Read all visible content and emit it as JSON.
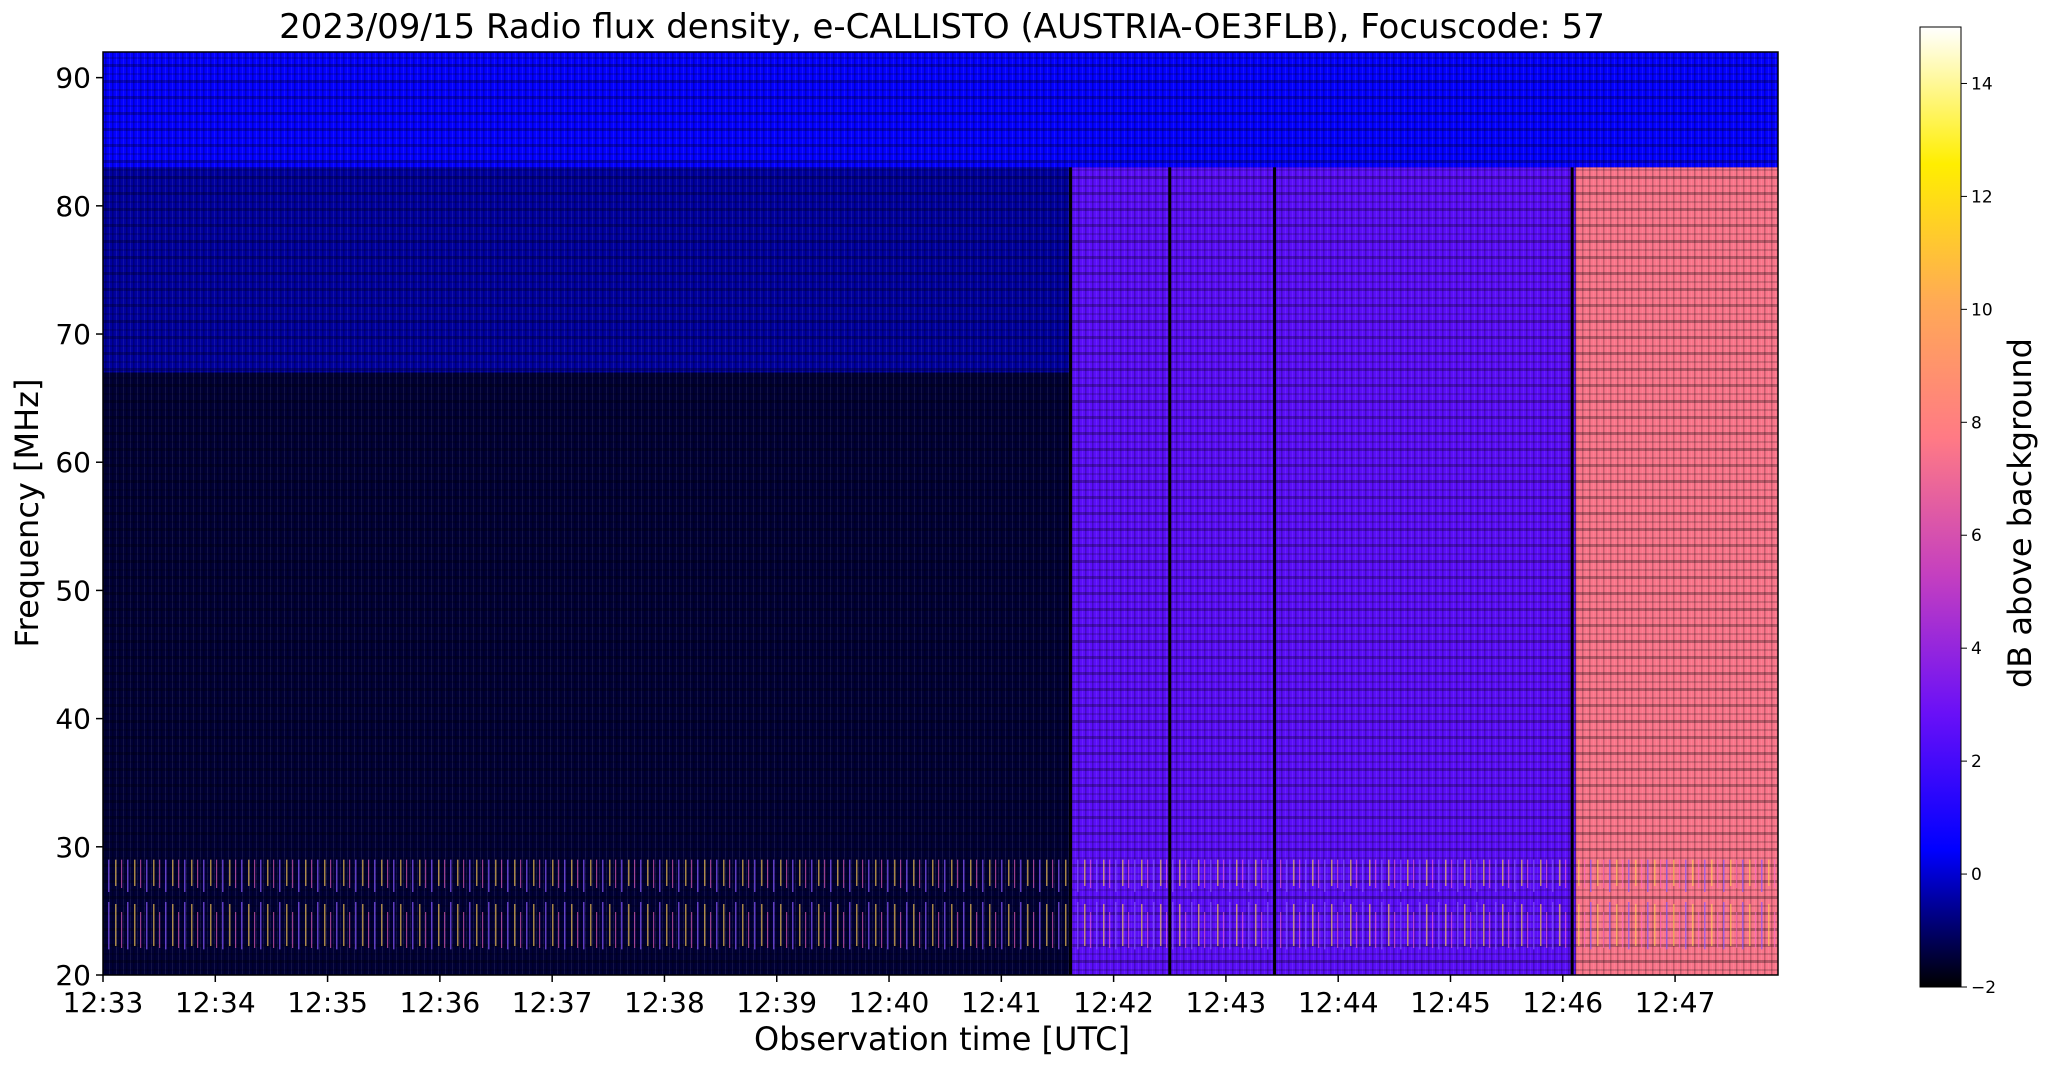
{
  "chart_data": [
    {
      "type": "heatmap",
      "title": "2023/09/15  Radio flux density, e-CALLISTO (AUSTRIA-OE3FLB), Focuscode: 57",
      "xlabel": "Observation time [UTC]",
      "ylabel": "Frequency [MHz]",
      "x_tick_labels": [
        "12:33",
        "12:34",
        "12:35",
        "12:36",
        "12:37",
        "12:38",
        "12:39",
        "12:40",
        "12:41",
        "12:42",
        "12:43",
        "12:44",
        "12:45",
        "12:46",
        "12:47"
      ],
      "y_ticks": [
        20,
        30,
        40,
        50,
        60,
        70,
        80,
        90
      ],
      "xlim": [
        "12:33",
        "12:47:55"
      ],
      "ylim": [
        20,
        92
      ],
      "colorbar": {
        "label": "dB above background",
        "range": [
          -2,
          15
        ],
        "ticks": [
          -2,
          0,
          2,
          4,
          6,
          8,
          10,
          12,
          14
        ],
        "colormap": "gnuplot2",
        "stops": [
          "#000000",
          "#0000ff",
          "#6a10f7",
          "#c43fc0",
          "#ff7a85",
          "#ffaa55",
          "#ffee00",
          "#ffffff"
        ]
      },
      "events": [
        {
          "time": "12:41:37",
          "description": "onset of broadband enhancement"
        },
        {
          "time": "12:46:07",
          "description": "further intensification"
        }
      ],
      "gaps": [
        "12:41:37",
        "12:42:30",
        "12:43:26",
        "12:46:05"
      ],
      "regions": [
        {
          "t_start": "12:33",
          "t_end": "12:41:37",
          "f_range": [
            20,
            67
          ],
          "db": -1.5
        },
        {
          "t_start": "12:33",
          "t_end": "12:41:37",
          "f_range": [
            67,
            83
          ],
          "db": -0.5
        },
        {
          "t_start": "12:33",
          "t_end": "12:47:55",
          "f_range": [
            83,
            92
          ],
          "db": 0.5
        },
        {
          "t_start": "12:41:37",
          "t_end": "12:46:07",
          "f_range": [
            20,
            83
          ],
          "db": 2.5
        },
        {
          "t_start": "12:46:07",
          "t_end": "12:47:55",
          "f_range": [
            20,
            83
          ],
          "db": 7.5
        }
      ],
      "interference_band_mhz": [
        22,
        29
      ]
    }
  ]
}
